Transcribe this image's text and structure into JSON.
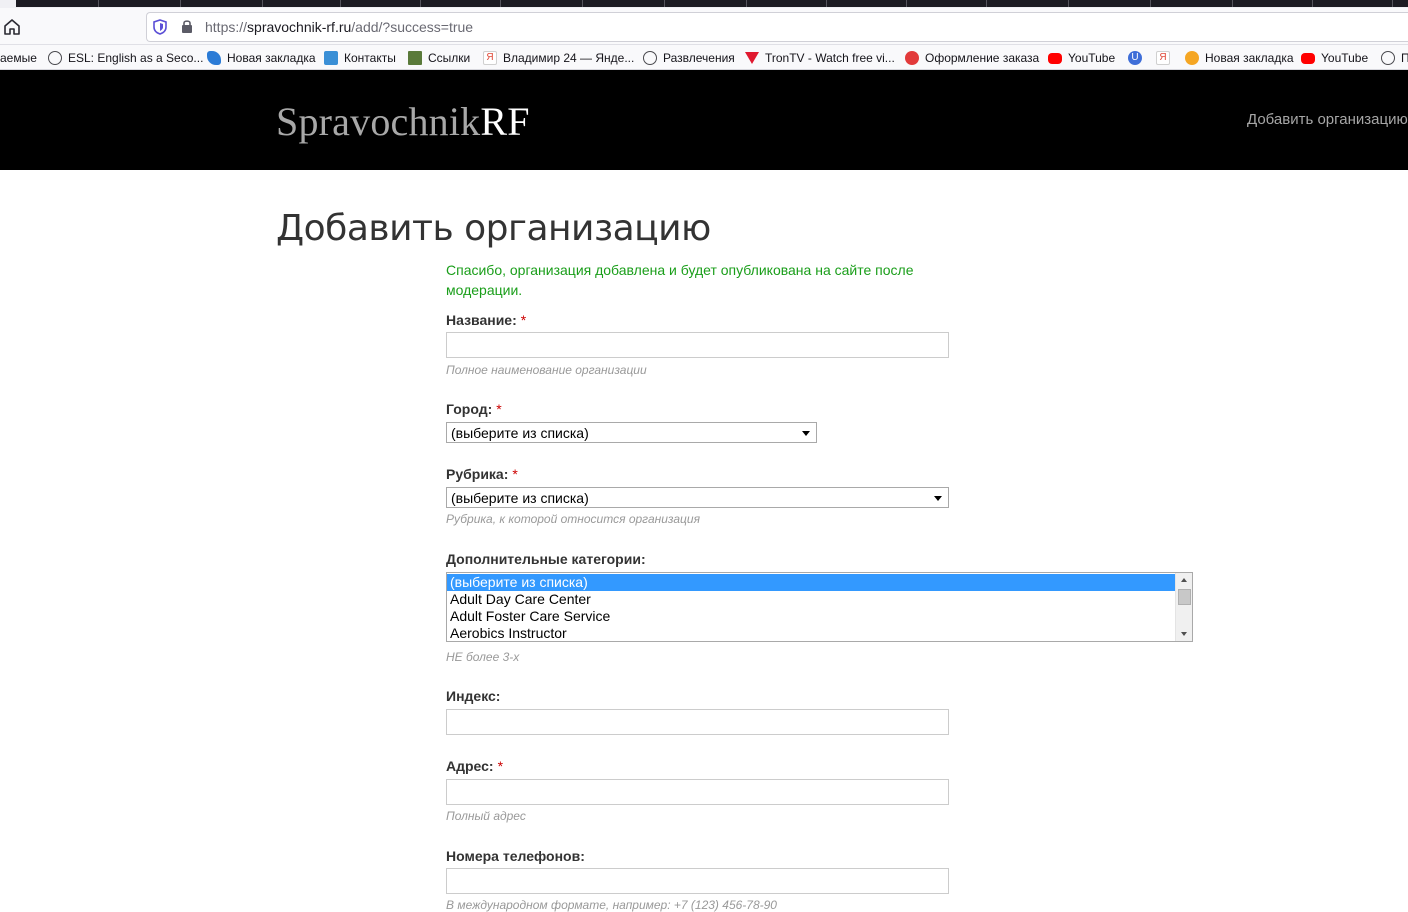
{
  "browser": {
    "url_scheme": "https://",
    "url_host": "spravochnik-rf.ru",
    "url_path": "/add/?success=true"
  },
  "bookmarks": [
    {
      "label": "аемые",
      "icon": "folder-icon",
      "color": "#f9f9fb"
    },
    {
      "label": "ESL: English as a Seco...",
      "icon": "globe-icon",
      "color": "#4a4a4f"
    },
    {
      "label": "Новая закладка",
      "icon": "butterfly-icon",
      "color": "#2b7bd6"
    },
    {
      "label": "Контакты",
      "icon": "contacts-icon",
      "color": "#3a8fd6"
    },
    {
      "label": "Ссылки",
      "icon": "avatar-icon",
      "color": "#5a7a3a"
    },
    {
      "label": "Владимир 24 — Янде...",
      "icon": "yandex-icon",
      "color": "#e04a3a"
    },
    {
      "label": "Развлечения",
      "icon": "globe-icon",
      "color": "#4a4a4f"
    },
    {
      "label": "TronTV - Watch free vi...",
      "icon": "tron-icon",
      "color": "#e0192f"
    },
    {
      "label": "Оформление заказа",
      "icon": "star-badge-icon",
      "color": "#e23a3a"
    },
    {
      "label": "YouTube",
      "icon": "youtube-icon",
      "color": "#ff0000"
    },
    {
      "label": "",
      "icon": "u-icon",
      "color": "#3f6ed8"
    },
    {
      "label": "",
      "icon": "yandex-icon",
      "color": "#e04a3a"
    },
    {
      "label": "Новая закладка",
      "icon": "music-icon",
      "color": "#f5a623"
    },
    {
      "label": "YouTube",
      "icon": "youtube-icon",
      "color": "#ff0000"
    },
    {
      "label": "П",
      "icon": "globe-icon",
      "color": "#4a4a4f"
    }
  ],
  "site": {
    "logo_part1": "Spravochnik",
    "logo_part2": "RF",
    "nav_add": "Добавить организацию"
  },
  "page": {
    "title": "Добавить организацию",
    "success_message": "Спасибо, организация добавлена и будет опубликована на сайте после модерации."
  },
  "form": {
    "name_label": "Название:",
    "name_value": "",
    "name_hint": "Полное наименование организации",
    "city_label": "Город:",
    "city_value": "(выберите из списка)",
    "rubric_label": "Рубрика:",
    "rubric_value": "(выберите из списка)",
    "rubric_hint": "Рубрика, к которой относится организация",
    "extra_label": "Дополнительные категории:",
    "extra_options": [
      "(выберите из списка)",
      "Adult Day Care Center",
      "Adult Foster Care Service",
      "Aerobics Instructor"
    ],
    "extra_hint": "НЕ более 3-х",
    "index_label": "Индекс:",
    "index_value": "",
    "address_label": "Адрес:",
    "address_value": "",
    "address_hint": "Полный адрес",
    "phones_label": "Номера телефонов:",
    "phones_value": "",
    "phones_hint": "В международном формате, например: +7 (123) 456-78-90",
    "required_mark": "*"
  }
}
